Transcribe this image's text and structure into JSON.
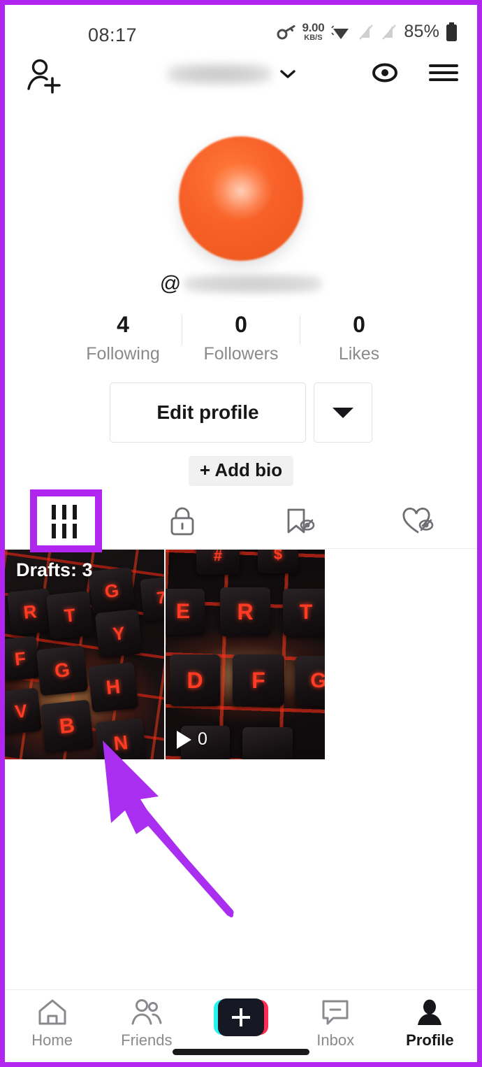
{
  "status_bar": {
    "time": "08:17",
    "vpn_icon": "key-icon",
    "network_speed_value": "9.00",
    "network_speed_unit": "KB/S",
    "wifi_icon": "wifi-icon",
    "sim1_icon": "signal-off-icon",
    "sim2_icon": "signal-off-icon",
    "battery_percent": "85%",
    "battery_icon": "battery-icon"
  },
  "header": {
    "add_user_icon": "add-user-icon",
    "username_masked": "",
    "chevron_icon": "chevron-down-icon",
    "views_icon": "eye-icon",
    "menu_icon": "hamburger-menu-icon"
  },
  "profile": {
    "avatar_alt": "avatar",
    "at_symbol": "@",
    "handle_masked": "",
    "stats": [
      {
        "count": "4",
        "label": "Following"
      },
      {
        "count": "0",
        "label": "Followers"
      },
      {
        "count": "0",
        "label": "Likes"
      }
    ],
    "edit_profile_label": "Edit profile",
    "dropdown_icon": "caret-down-icon",
    "add_bio_label": "+ Add bio"
  },
  "tabs": [
    {
      "name": "posts",
      "icon": "grid-icon",
      "active": true,
      "highlighted": true
    },
    {
      "name": "private",
      "icon": "lock-icon",
      "active": false,
      "highlighted": false
    },
    {
      "name": "saved",
      "icon": "bookmark-hidden-icon",
      "active": false,
      "highlighted": false
    },
    {
      "name": "liked",
      "icon": "heart-hidden-icon",
      "active": false,
      "highlighted": false
    }
  ],
  "grid": {
    "items": [
      {
        "badge": "Drafts: 3",
        "play_count": "",
        "thumb_alt": "red-backlit-keyboard",
        "keys": [
          "R",
          "T",
          "Y",
          "F",
          "G",
          "H",
          "V",
          "B",
          "N"
        ]
      },
      {
        "badge": "",
        "play_count": "0",
        "thumb_alt": "red-backlit-keyboard-closeup",
        "keys": [
          "E",
          "R",
          "D",
          "F"
        ]
      }
    ]
  },
  "annotation": {
    "arrow_color": "#a92ef0",
    "highlight_color": "#b026f0"
  },
  "bottom_nav": [
    {
      "label": "Home",
      "icon": "home-icon",
      "active": false
    },
    {
      "label": "Friends",
      "icon": "friends-icon",
      "active": false
    },
    {
      "label": "",
      "icon": "create-plus-icon",
      "active": false
    },
    {
      "label": "Inbox",
      "icon": "inbox-icon",
      "active": false
    },
    {
      "label": "Profile",
      "icon": "profile-icon",
      "active": true
    }
  ]
}
